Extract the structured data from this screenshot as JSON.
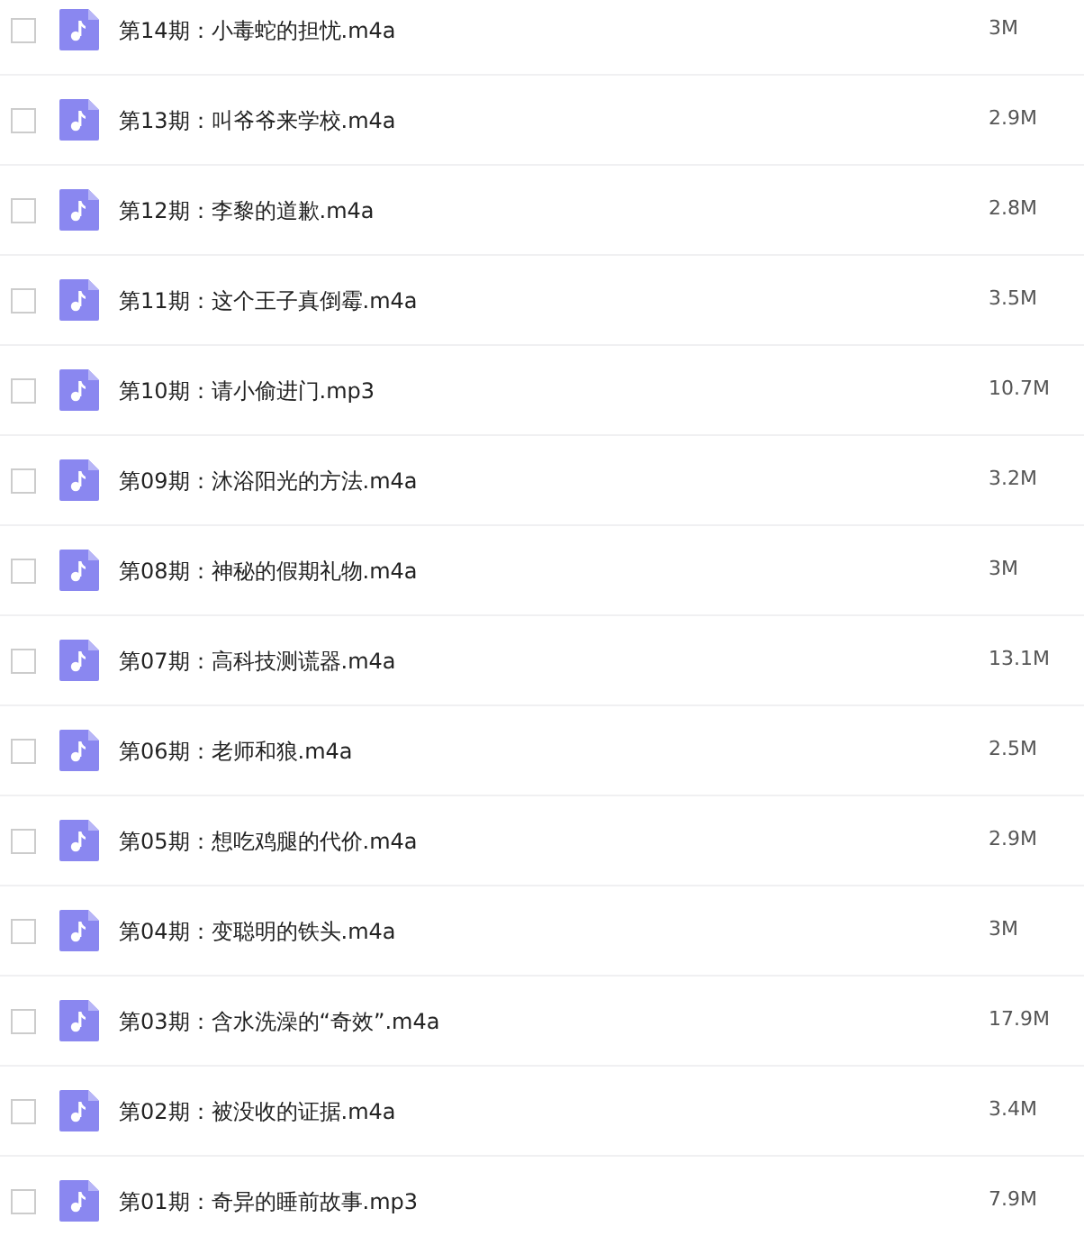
{
  "files": [
    {
      "name": "第14期：小毒蛇的担忧.m4a",
      "size": "3M",
      "checked": false
    },
    {
      "name": "第13期：叫爷爷来学校.m4a",
      "size": "2.9M",
      "checked": false
    },
    {
      "name": "第12期：李黎的道歉.m4a",
      "size": "2.8M",
      "checked": false
    },
    {
      "name": "第11期：这个王子真倒霉.m4a",
      "size": "3.5M",
      "checked": false
    },
    {
      "name": "第10期：请小偷进门.mp3",
      "size": "10.7M",
      "checked": false
    },
    {
      "name": "第09期：沐浴阳光的方法.m4a",
      "size": "3.2M",
      "checked": false
    },
    {
      "name": "第08期：神秘的假期礼物.m4a",
      "size": "3M",
      "checked": false
    },
    {
      "name": "第07期：高科技测谎器.m4a",
      "size": "13.1M",
      "checked": false
    },
    {
      "name": "第06期：老师和狼.m4a",
      "size": "2.5M",
      "checked": false
    },
    {
      "name": "第05期：想吃鸡腿的代价.m4a",
      "size": "2.9M",
      "checked": false
    },
    {
      "name": "第04期：变聪明的铁头.m4a",
      "size": "3M",
      "checked": false
    },
    {
      "name": "第03期：含水洗澡的“奇效”.m4a",
      "size": "17.9M",
      "checked": false
    },
    {
      "name": "第02期：被没收的证据.m4a",
      "size": "3.4M",
      "checked": false
    },
    {
      "name": "第01期：奇异的睡前故事.mp3",
      "size": "7.9M",
      "checked": false
    }
  ]
}
